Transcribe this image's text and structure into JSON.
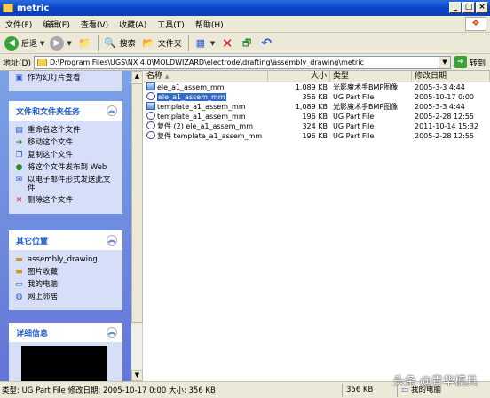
{
  "window": {
    "title": "metric"
  },
  "menu": [
    "文件(F)",
    "编辑(E)",
    "查看(V)",
    "收藏(A)",
    "工具(T)",
    "帮助(H)"
  ],
  "toolbar": {
    "back": "后退",
    "search": "搜索",
    "folders": "文件夹"
  },
  "address": {
    "label": "地址(D)",
    "path": "D:\\Program Files\\UGS\\NX 4.0\\MOLDWIZARD\\electrode\\drafting\\assembly_drawing\\metric",
    "go": "转到"
  },
  "leftpane": {
    "top_item": "作为幻灯片查看",
    "file_tasks": {
      "title": "文件和文件夹任务",
      "items": [
        "重命名这个文件",
        "移动这个文件",
        "复制这个文件",
        "将这个文件发布到 Web",
        "以电子邮件形式发送此文件",
        "删除这个文件"
      ]
    },
    "other_places": {
      "title": "其它位置",
      "items": [
        "assembly_drawing",
        "图片收藏",
        "我的电脑",
        "网上邻居"
      ]
    },
    "details": {
      "title": "详细信息"
    }
  },
  "columns": {
    "name": "名称",
    "size": "大小",
    "type": "类型",
    "date": "修改日期"
  },
  "files": [
    {
      "name": "ele_a1_assem_mm",
      "size": "1,089 KB",
      "type": "光影魔术手BMP图像",
      "date": "2005-3-3 4:44",
      "icon": "bmp-icon"
    },
    {
      "name": "ele_a1_assem_mm",
      "size": "356 KB",
      "type": "UG Part File",
      "date": "2005-10-17 0:00",
      "icon": "ug-part-icon"
    },
    {
      "name": "template_a1_assem_mm",
      "size": "1,089 KB",
      "type": "光影魔术手BMP图像",
      "date": "2005-3-3 4:44",
      "icon": "bmp-icon"
    },
    {
      "name": "template_a1_assem_mm",
      "size": "196 KB",
      "type": "UG Part File",
      "date": "2005-2-28 12:55",
      "icon": "ug-part-icon"
    },
    {
      "name": "复件 (2) ele_a1_assem_mm",
      "size": "324 KB",
      "type": "UG Part File",
      "date": "2011-10-14 15:32",
      "icon": "ug-part-icon"
    },
    {
      "name": "复件 template_a1_assem_mm",
      "size": "196 KB",
      "type": "UG Part File",
      "date": "2005-2-28 12:55",
      "icon": "ug-part-icon"
    }
  ],
  "status": {
    "text": "类型: UG Part File 修改日期: 2005-10-17 0:00 大小: 356 KB",
    "size": "356 KB",
    "location": "我的电脑"
  },
  "watermark": "头条 @青华模具"
}
